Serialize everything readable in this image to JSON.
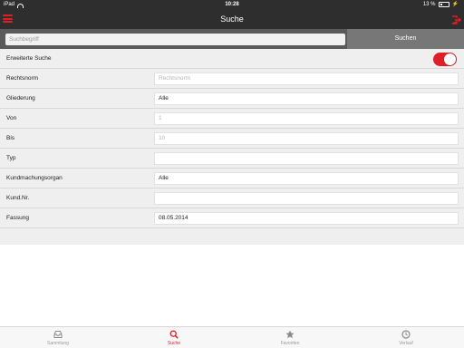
{
  "status_bar": {
    "carrier": "iPad",
    "time": "10:28",
    "battery": "13 %"
  },
  "nav": {
    "title": "Suche"
  },
  "search": {
    "placeholder": "Suchbegriff",
    "value": "",
    "button_label": "Suchen"
  },
  "form": {
    "advanced_label": "Erweiterte Suche",
    "advanced_enabled": true,
    "rows": [
      {
        "label": "Rechtsnorm",
        "value": "",
        "placeholder": "Rechtsnorm"
      },
      {
        "label": "Gliederung",
        "value": "Alle",
        "placeholder": ""
      },
      {
        "label": "Von",
        "value": "",
        "placeholder": "1"
      },
      {
        "label": "Bis",
        "value": "",
        "placeholder": "10"
      },
      {
        "label": "Typ",
        "value": "",
        "placeholder": ""
      },
      {
        "label": "Kundmachungsorgan",
        "value": "Alle",
        "placeholder": ""
      },
      {
        "label": "Kund.Nr.",
        "value": "",
        "placeholder": ""
      },
      {
        "label": "Fassung",
        "value": "08.05.2014",
        "placeholder": ""
      }
    ]
  },
  "tabs": [
    {
      "label": "Sammlung",
      "icon": "inbox-icon",
      "active": false
    },
    {
      "label": "Suche",
      "icon": "search-icon",
      "active": true
    },
    {
      "label": "Favoriten",
      "icon": "star-icon",
      "active": false
    },
    {
      "label": "Verlauf",
      "icon": "clock-icon",
      "active": false
    }
  ],
  "colors": {
    "accent": "#e01e26",
    "bar": "#2e2e2e",
    "search_bar": "#5a5a5a",
    "form_bg": "#efefef"
  }
}
